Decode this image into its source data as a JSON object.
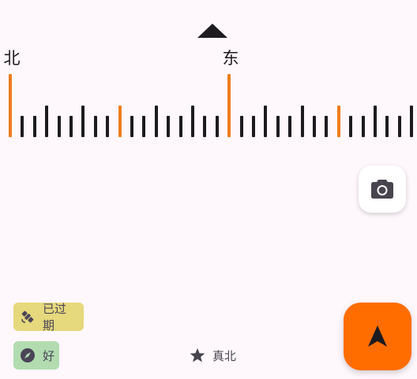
{
  "compass": {
    "labels": [
      {
        "text": "北",
        "name": "cardinal-north-label"
      },
      {
        "text": "东",
        "name": "cardinal-east-label"
      }
    ]
  },
  "status": {
    "gps_label": "已过期",
    "accuracy_label": "好",
    "north_label": "真北"
  },
  "icons": {
    "pointer": "heading-pointer-icon",
    "camera": "camera-icon",
    "gps": "satellite-icon",
    "accuracy": "compass-icon",
    "north": "star-icon",
    "navigation": "navigation-arrow-icon"
  },
  "colors": {
    "background": "#fef7fc",
    "accent": "#ee7d1c",
    "tick": "#1d1b20",
    "fab": "#ff6d00",
    "gps_chip": "#e6d87c",
    "accuracy_chip": "#b2dcb0"
  }
}
